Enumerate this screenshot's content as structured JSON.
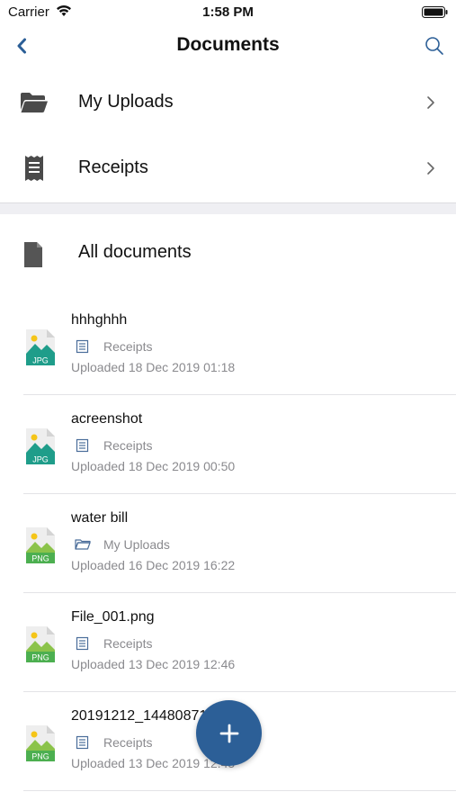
{
  "status_bar": {
    "carrier": "Carrier",
    "time": "1:58 PM"
  },
  "nav": {
    "title": "Documents",
    "back_icon": "chevron-left-icon",
    "search_icon": "search-icon"
  },
  "folders": [
    {
      "label": "My Uploads",
      "icon": "folder-open-icon"
    },
    {
      "label": "Receipts",
      "icon": "receipt-icon"
    }
  ],
  "all_documents": {
    "label": "All documents",
    "icon": "document-icon"
  },
  "documents": [
    {
      "name": "hhhghhh",
      "type": "JPG",
      "folder": "Receipts",
      "uploaded": "Uploaded 18 Dec 2019 01:18"
    },
    {
      "name": "acreenshot",
      "type": "JPG",
      "folder": "Receipts",
      "uploaded": "Uploaded 18 Dec 2019 00:50"
    },
    {
      "name": "water bill",
      "type": "PNG",
      "folder": "My Uploads",
      "uploaded": "Uploaded 16 Dec 2019 16:22"
    },
    {
      "name": "File_001.png",
      "type": "PNG",
      "folder": "Receipts",
      "uploaded": "Uploaded 13 Dec 2019 12:46"
    },
    {
      "name": "20191212_144808717.png",
      "type": "PNG",
      "folder": "Receipts",
      "uploaded": "Uploaded 13 Dec 2019 12:45"
    }
  ],
  "fab": {
    "icon": "plus-icon"
  },
  "colors": {
    "accent": "#2c5f97",
    "jpg": "#1f9d8a",
    "png": "#4caf50"
  }
}
